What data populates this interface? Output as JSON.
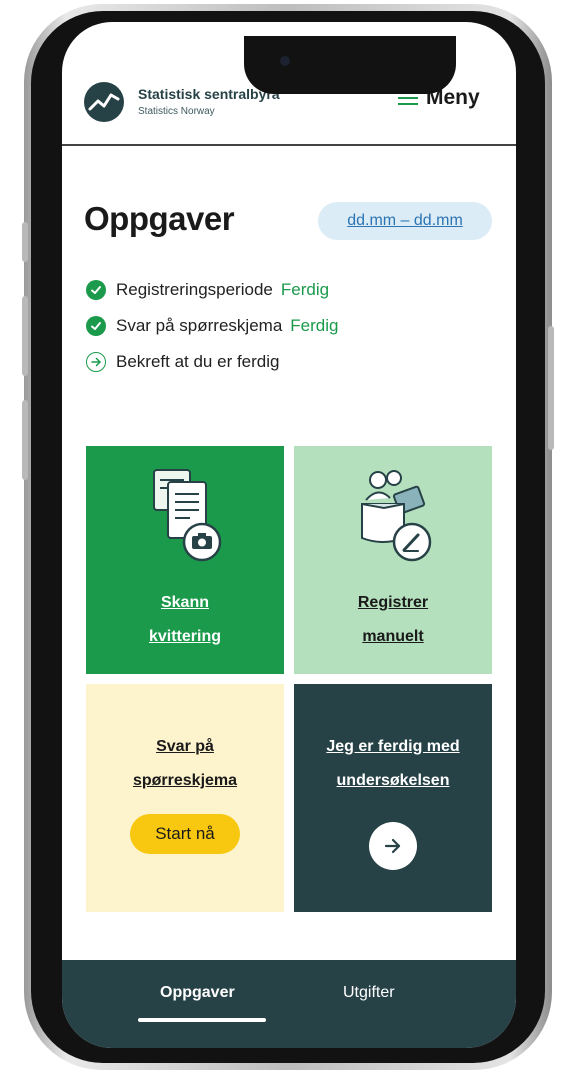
{
  "header": {
    "org_name": "Statistisk sentralbyrå",
    "org_sub": "Statistics Norway",
    "menu_label": "Meny"
  },
  "page": {
    "title": "Oppgaver",
    "date_range": "dd.mm – dd.mm"
  },
  "steps": [
    {
      "label": "Registreringsperiode",
      "status": "Ferdig",
      "state": "done"
    },
    {
      "label": "Svar på spørreskjema",
      "status": "Ferdig",
      "state": "done"
    },
    {
      "label": "Bekreft at du er ferdig",
      "status": "",
      "state": "next"
    }
  ],
  "tiles": {
    "scan": {
      "line1": "Skann",
      "line2": "kvittering",
      "icon": "receipt-camera-icon"
    },
    "manual": {
      "line1": "Registrer",
      "line2": "manuelt",
      "icon": "manual-entry-icon"
    },
    "survey": {
      "line1": "Svar på",
      "line2": "spørreskjema",
      "button": "Start nå"
    },
    "done": {
      "line1": "Jeg er ferdig med",
      "line2": "undersøkelsen",
      "icon": "arrow-right-icon"
    }
  },
  "bottom_nav": {
    "tabs": [
      {
        "label": "Oppgaver",
        "active": true
      },
      {
        "label": "Utgifter",
        "active": false
      }
    ]
  },
  "colors": {
    "brand_green": "#1b9a4c",
    "light_green": "#b4e0bd",
    "dark_teal": "#274247",
    "cream": "#fdf3cc",
    "yellow": "#f7c80f",
    "link_blue": "#2c74b3"
  }
}
